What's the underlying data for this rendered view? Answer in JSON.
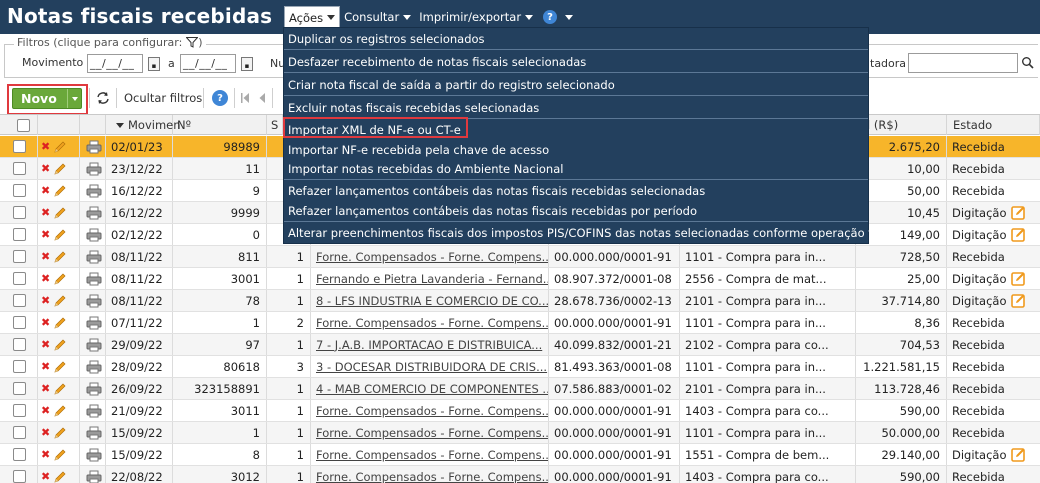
{
  "header": {
    "title": "Notas fiscais recebidas",
    "menu": [
      "Ações",
      "Consultar",
      "Imprimir/exportar"
    ],
    "help_glyph": "?"
  },
  "filters": {
    "legend": "Filtros (clique para configurar:",
    "movimento_label": "Movimento",
    "date_from": "__/__/__",
    "a_label": "a",
    "date_to": "__/__/__",
    "partial_label": "Nu",
    "right_label": "tadora",
    "icons": [
      "funnel-icon",
      "calendar-icon",
      "search-icon"
    ]
  },
  "toolbar": {
    "novo": "Novo",
    "ocultar_filtros": "Ocultar filtros",
    "icons": [
      "refresh-icon",
      "help-icon",
      "first-page-icon",
      "prev-page-icon"
    ]
  },
  "actions_menu": {
    "items": [
      "Duplicar os registros selecionados",
      "Desfazer recebimento de notas fiscais selecionadas",
      "Criar nota fiscal de saída a partir do registro selecionado",
      "Excluir notas fiscais recebidas selecionadas",
      "Importar XML de NF-e ou CT-e",
      "Importar NF-e recebida pela chave de acesso",
      "Importar notas recebidas do Ambiente Nacional",
      "Refazer lançamentos contábeis das notas fiscais recebidas selecionadas",
      "Refazer lançamentos contábeis das notas fiscais recebidas por período",
      "Alterar preenchimentos fiscais dos impostos PIS/COFINS das notas selecionadas conforme operação fiscal"
    ]
  },
  "table": {
    "columns": [
      "Movimen",
      "Nº",
      "S",
      "al (R$)",
      "Estado"
    ],
    "rows": [
      {
        "date": "02/01/23",
        "num": "98989",
        "serie": "",
        "fornecedor": "",
        "cnpj": "",
        "cfop": "",
        "valor": "2.675,20",
        "estado": "Recebida",
        "edit": false
      },
      {
        "date": "23/12/22",
        "num": "11",
        "serie": "",
        "fornecedor": "",
        "cnpj": "",
        "cfop": "",
        "valor": "10,00",
        "estado": "Recebida",
        "edit": false
      },
      {
        "date": "16/12/22",
        "num": "9",
        "serie": "",
        "fornecedor": "",
        "cnpj": "",
        "cfop": "",
        "valor": "50,00",
        "estado": "Recebida",
        "edit": false
      },
      {
        "date": "16/12/22",
        "num": "9999",
        "serie": "",
        "fornecedor": "",
        "cnpj": "",
        "cfop": "",
        "valor": "10,45",
        "estado": "Digitação",
        "edit": true
      },
      {
        "date": "02/12/22",
        "num": "0",
        "serie": "",
        "fornecedor": "",
        "cnpj": "",
        "cfop": "",
        "valor": "149,00",
        "estado": "Digitação",
        "edit": true
      },
      {
        "date": "08/11/22",
        "num": "811",
        "serie": "1",
        "fornecedor": "Forne. Compensados - Forne. Compens...",
        "cnpj": "00.000.000/0001-91",
        "cfop": "1101 - Compra para in...",
        "valor": "728,50",
        "estado": "Recebida",
        "edit": false
      },
      {
        "date": "08/11/22",
        "num": "3001",
        "serie": "1",
        "fornecedor": "Fernando e Pietra Lavanderia - Fernand...",
        "cnpj": "08.907.372/0001-08",
        "cfop": "2556 - Compra de mat...",
        "valor": "25,00",
        "estado": "Digitação",
        "edit": true
      },
      {
        "date": "08/11/22",
        "num": "78",
        "serie": "1",
        "fornecedor": "8 - LFS INDUSTRIA E COMERCIO DE CO...",
        "cnpj": "28.678.736/0002-13",
        "cfop": "2101 - Compra para in...",
        "valor": "37.714,80",
        "estado": "Digitação",
        "edit": true
      },
      {
        "date": "07/11/22",
        "num": "1",
        "serie": "2",
        "fornecedor": "Forne. Compensados - Forne. Compens...",
        "cnpj": "00.000.000/0001-91",
        "cfop": "1101 - Compra para in...",
        "valor": "8,36",
        "estado": "Recebida",
        "edit": false
      },
      {
        "date": "29/09/22",
        "num": "97",
        "serie": "1",
        "fornecedor": "7 - J.A.B. IMPORTACAO E DISTRIBUICA...",
        "cnpj": "40.099.832/0001-21",
        "cfop": "2102 - Compra para co...",
        "valor": "704,53",
        "estado": "Recebida",
        "edit": false
      },
      {
        "date": "28/09/22",
        "num": "80618",
        "serie": "3",
        "fornecedor": "3 - DOCESAR DISTRIBUIDORA DE CRIS...",
        "cnpj": "81.493.363/0001-08",
        "cfop": "1101 - Compra para in...",
        "valor": "1.221.581,15",
        "estado": "Recebida",
        "edit": false
      },
      {
        "date": "26/09/22",
        "num": "323158891",
        "serie": "1",
        "fornecedor": "4 - MAB COMERCIO DE COMPONENTES ...",
        "cnpj": "07.586.883/0001-02",
        "cfop": "2101 - Compra para in...",
        "valor": "113.728,46",
        "estado": "Recebida",
        "edit": false
      },
      {
        "date": "21/09/22",
        "num": "3011",
        "serie": "1",
        "fornecedor": "Forne. Compensados - Forne. Compens...",
        "cnpj": "00.000.000/0001-91",
        "cfop": "1403 - Compra para co...",
        "valor": "590,00",
        "estado": "Recebida",
        "edit": false
      },
      {
        "date": "15/09/22",
        "num": "1",
        "serie": "1",
        "fornecedor": "Forne. Compensados - Forne. Compens...",
        "cnpj": "00.000.000/0001-91",
        "cfop": "1101 - Compra para in...",
        "valor": "50.000,00",
        "estado": "Recebida",
        "edit": false
      },
      {
        "date": "15/09/22",
        "num": "8",
        "serie": "1",
        "fornecedor": "Forne. Compensados - Forne. Compens...",
        "cnpj": "00.000.000/0001-91",
        "cfop": "1551 - Compra de bem...",
        "valor": "29.140,00",
        "estado": "Digitação",
        "edit": true
      },
      {
        "date": "22/08/22",
        "num": "3012",
        "serie": "1",
        "fornecedor": "Forne. Compensados - Forne. Compens...",
        "cnpj": "00.000.000/0001-91",
        "cfop": "1403 - Compra para co...",
        "valor": "590,00",
        "estado": "Recebida",
        "edit": false
      }
    ]
  },
  "colors": {
    "header_bg": "#23405e",
    "selected_row": "#f7b52a",
    "novo_green": "#6aa83a",
    "highlight_red": "#e0393e",
    "edit_orange": "#f09a1d"
  }
}
